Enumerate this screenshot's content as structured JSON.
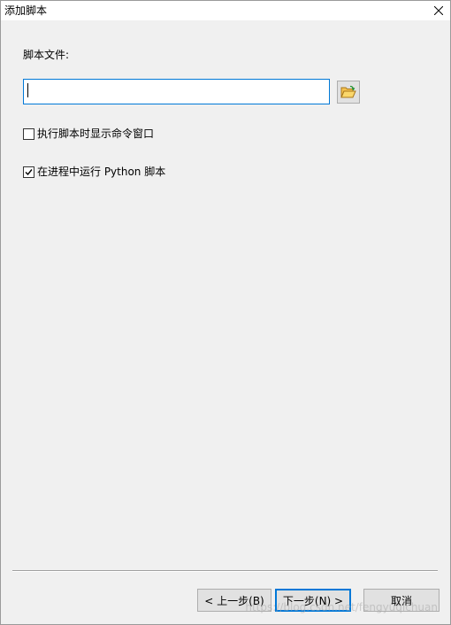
{
  "window": {
    "title": "添加脚本"
  },
  "form": {
    "file_label": "脚本文件:",
    "file_value": "",
    "options": [
      {
        "label": "执行脚本时显示命令窗口",
        "checked": false
      },
      {
        "label": "在进程中运行 Python 脚本",
        "checked": true
      }
    ]
  },
  "buttons": {
    "prev": "< 上一步(B)",
    "next": "下一步(N) >",
    "cancel": "取消"
  },
  "watermark": "https://blog.csdn.net/fengyuqichuan",
  "icons": {
    "close": "close-icon",
    "browse": "folder-open-icon",
    "check": "checkmark-icon"
  },
  "colors": {
    "focus_border": "#0078d7",
    "dialog_bg": "#f0f0f0",
    "button_bg": "#e1e1e1"
  }
}
